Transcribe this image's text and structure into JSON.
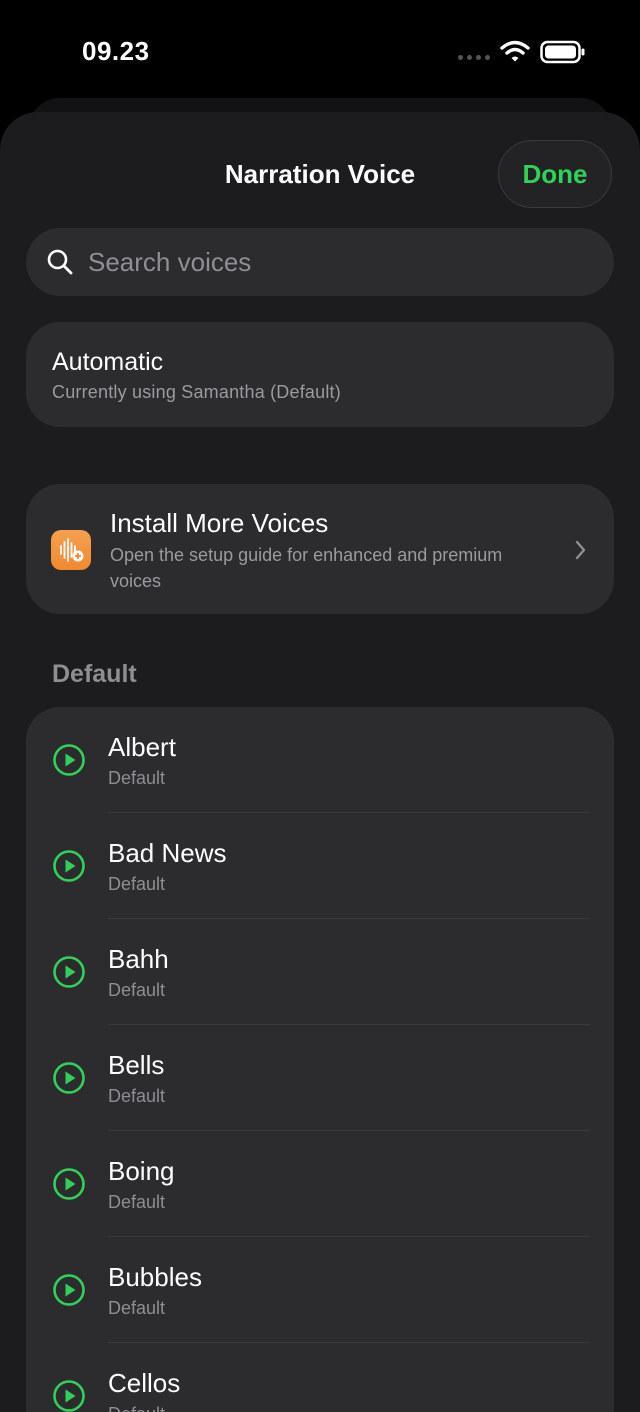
{
  "status": {
    "time": "09.23"
  },
  "header": {
    "title": "Narration Voice",
    "done_label": "Done"
  },
  "search": {
    "placeholder": "Search voices",
    "value": ""
  },
  "automatic": {
    "title": "Automatic",
    "subtitle": "Currently using Samantha (Default)"
  },
  "install": {
    "title": "Install More Voices",
    "subtitle": "Open the setup guide for enhanced and premium voices"
  },
  "section": {
    "title": "Default"
  },
  "voices": [
    {
      "name": "Albert",
      "category": "Default"
    },
    {
      "name": "Bad News",
      "category": "Default"
    },
    {
      "name": "Bahh",
      "category": "Default"
    },
    {
      "name": "Bells",
      "category": "Default"
    },
    {
      "name": "Boing",
      "category": "Default"
    },
    {
      "name": "Bubbles",
      "category": "Default"
    },
    {
      "name": "Cellos",
      "category": "Default"
    }
  ],
  "colors": {
    "accent": "#30d158",
    "install_icon": "#f39a3f",
    "sheet": "#1c1c1e",
    "card": "#2c2c2e"
  },
  "icons": {
    "search": "search-icon",
    "play": "play-circle-icon",
    "chevron": "chevron-right-icon",
    "install": "waveform-plus-icon"
  }
}
